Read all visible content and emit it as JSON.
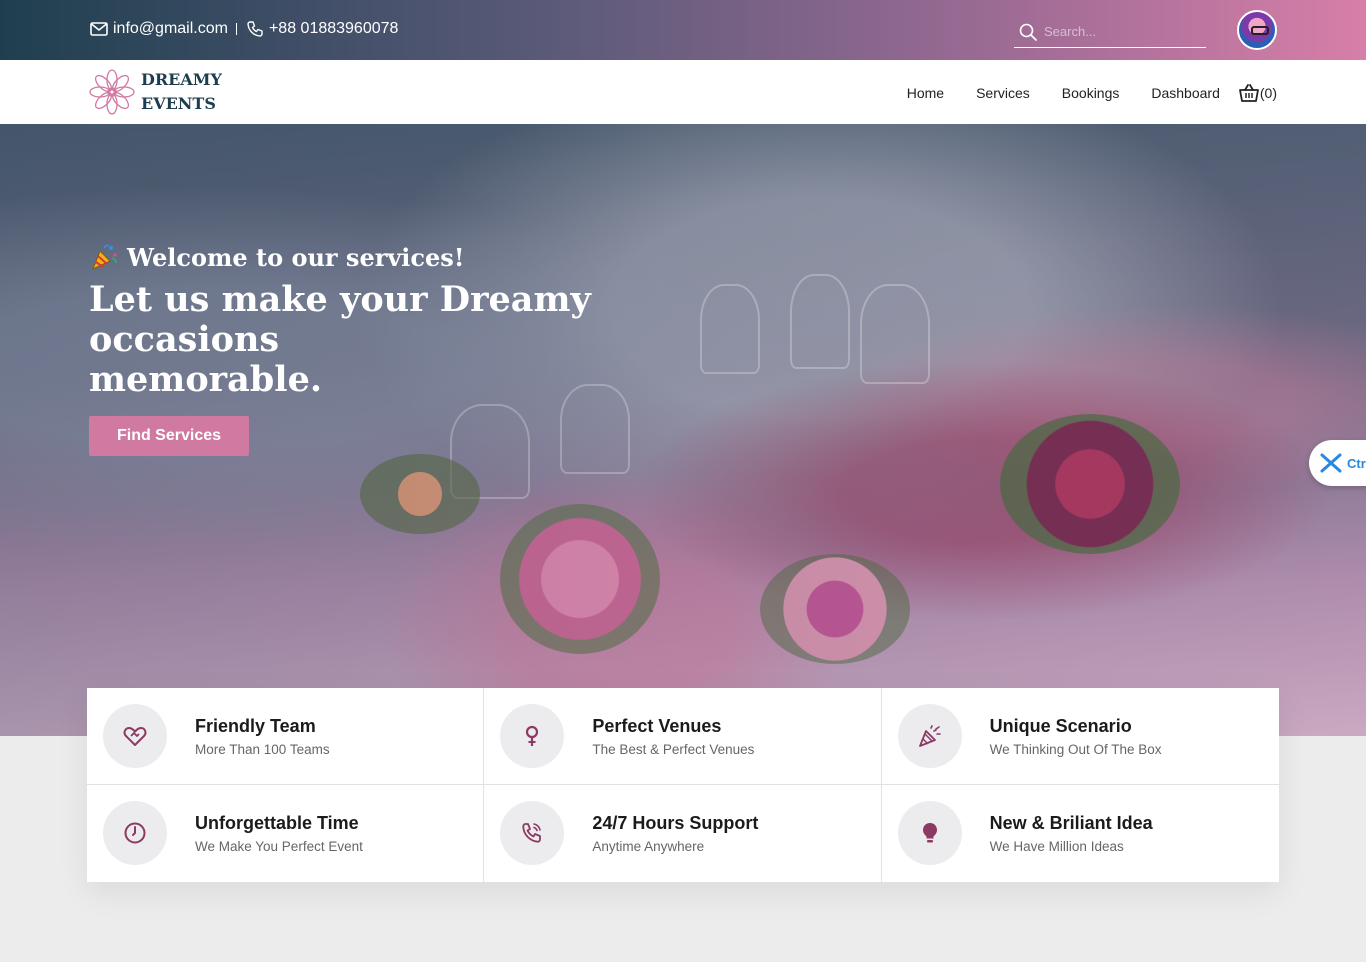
{
  "topbar": {
    "email": "info@gmail.com",
    "phone": "+88 01883960078",
    "search_placeholder": "Search...",
    "icons": [
      "mail-icon",
      "phone-icon",
      "search-icon"
    ]
  },
  "brand": {
    "line1": "DREAMY",
    "line2": "EVENTS",
    "accent": "#d07aa2",
    "dark": "#1e3d4e"
  },
  "nav": {
    "items": [
      {
        "label": "Home"
      },
      {
        "label": "Services"
      },
      {
        "label": "Bookings"
      },
      {
        "label": "Dashboard"
      }
    ],
    "cart_count": "(0)"
  },
  "hero": {
    "welcome": "Welcome to our services!",
    "headline_1": "Let us make your Dreamy",
    "headline_2": "occasions",
    "headline_3": "memorable.",
    "cta": "Find Services",
    "side_pill_text": "Ctr"
  },
  "features": [
    {
      "icon": "heart-handshake-icon",
      "title": "Friendly Team",
      "subtitle": "More Than 100 Teams"
    },
    {
      "icon": "location-pin-icon",
      "title": "Perfect Venues",
      "subtitle": "The Best & Perfect Venues"
    },
    {
      "icon": "party-popper-icon",
      "title": "Unique Scenario",
      "subtitle": "We Thinking Out Of The Box"
    },
    {
      "icon": "clock-icon",
      "title": "Unforgettable Time",
      "subtitle": "We Make You Perfect Event"
    },
    {
      "icon": "phone-call-icon",
      "title": "24/7 Hours Support",
      "subtitle": "Anytime Anywhere"
    },
    {
      "icon": "lightbulb-icon",
      "title": "New & Briliant Idea",
      "subtitle": "We Have Million Ideas"
    }
  ],
  "colors": {
    "icon_accent": "#8c3a63"
  }
}
